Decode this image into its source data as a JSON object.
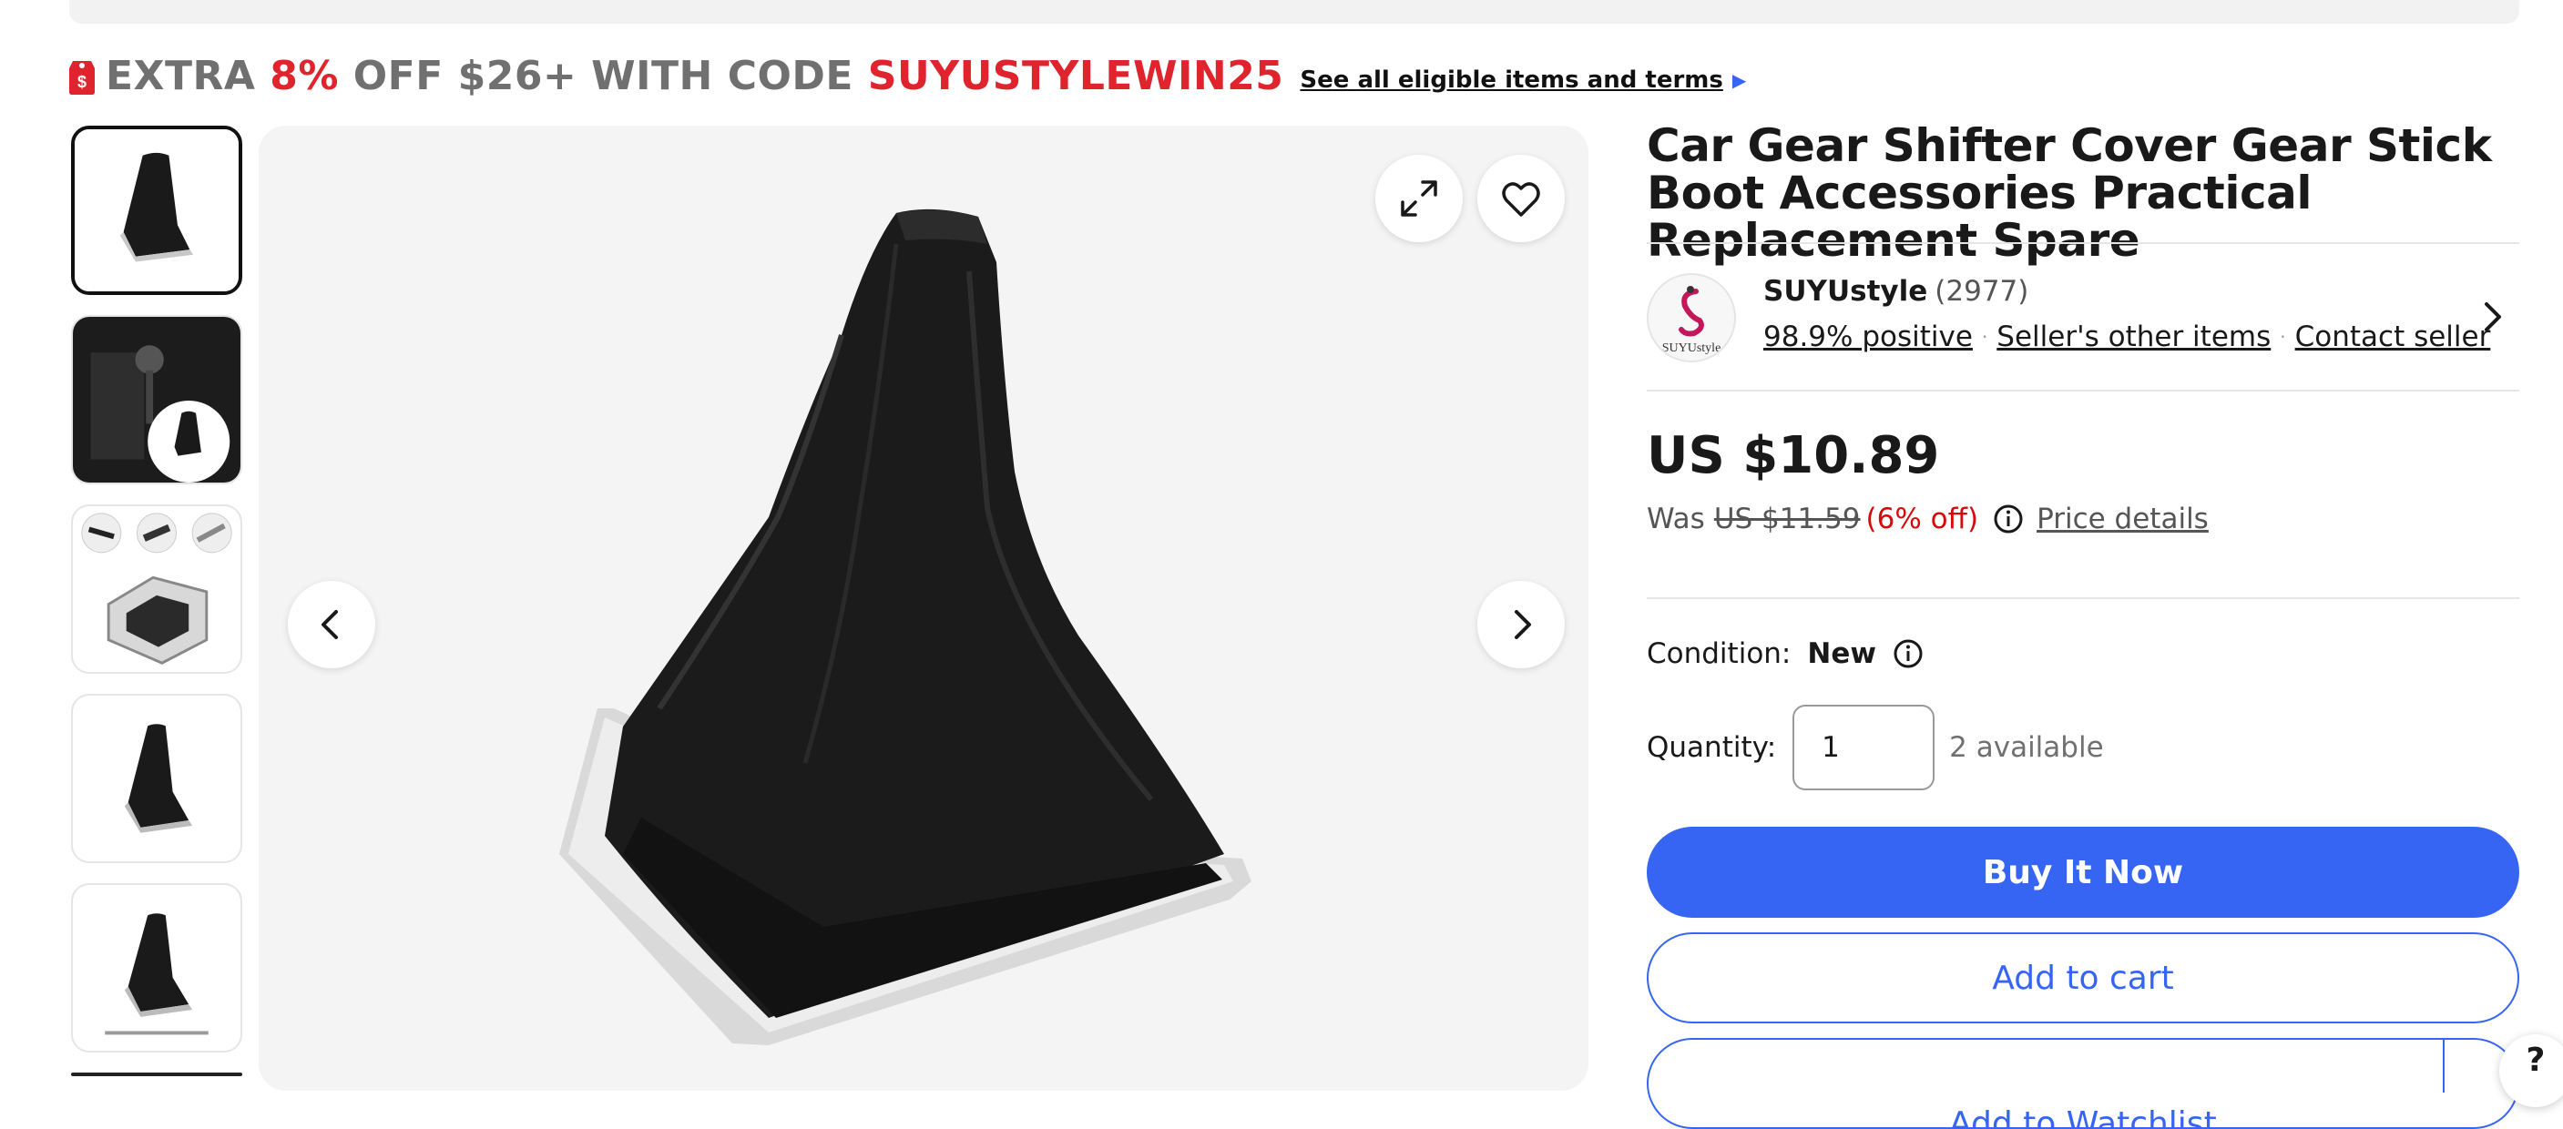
{
  "promo": {
    "prefix": "EXTRA ",
    "percent": "8%",
    "middle": " OFF $26+ WITH CODE ",
    "code": "SUYUSTYLEWIN25",
    "link": "See all eligible items and terms",
    "icon": "price-tag-icon"
  },
  "gallery": {
    "selected_index": 0,
    "thumbnails": [
      "thumbnail-1",
      "thumbnail-2",
      "thumbnail-3",
      "thumbnail-4",
      "thumbnail-5"
    ],
    "controls": {
      "expand_icon": "expand-icon",
      "watch_icon": "heart-icon",
      "prev_icon": "chevron-left-icon",
      "next_icon": "chevron-right-icon"
    }
  },
  "listing": {
    "title": "Car Gear Shifter Cover Gear Stick Boot Accessories Practical Replacement Spare",
    "seller": {
      "name": "SUYUstyle",
      "count": "(2977)",
      "logo_text": "SUYUstyle",
      "positive": "98.9% positive",
      "other_items": "Seller's other items",
      "contact": "Contact seller"
    },
    "price": "US $10.89",
    "was_label": "Was",
    "was_price": "US $11.59",
    "discount": "(6% off)",
    "price_details": "Price details",
    "condition_label": "Condition:",
    "condition_value": "New",
    "quantity_label": "Quantity:",
    "quantity_value": "1",
    "available": "2 available"
  },
  "actions": {
    "buy_now": "Buy It Now",
    "add_to_cart": "Add to cart",
    "add_to_watchlist": "Add to Watchlist"
  },
  "help": {
    "label": "?"
  },
  "colors": {
    "accent": "#3665f3",
    "promo_red": "#e0242e",
    "discount_red": "#d50b0b"
  }
}
